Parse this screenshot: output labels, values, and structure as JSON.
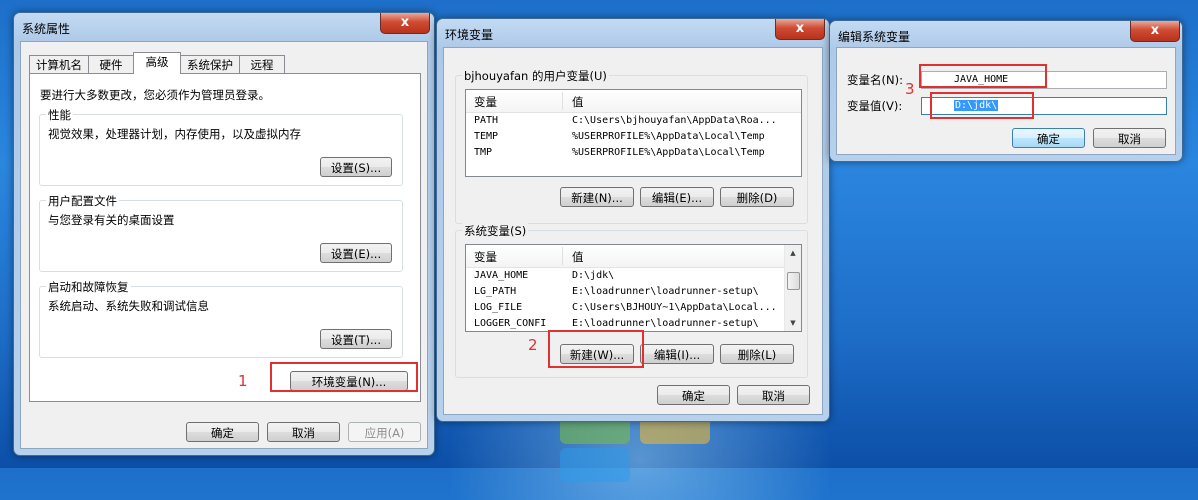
{
  "sysprops": {
    "title": "系统属性",
    "close": "x",
    "tabs": [
      "计算机名",
      "硬件",
      "高级",
      "系统保护",
      "远程"
    ],
    "admin_note": "要进行大多数更改，您必须作为管理员登录。",
    "perf": {
      "title": "性能",
      "desc": "视觉效果，处理器计划，内存使用，以及虚拟内存",
      "button": "设置(S)..."
    },
    "profile": {
      "title": "用户配置文件",
      "desc": "与您登录有关的桌面设置",
      "button": "设置(E)..."
    },
    "startup": {
      "title": "启动和故障恢复",
      "desc": "系统启动、系统失败和调试信息",
      "button": "设置(T)..."
    },
    "env_button": "环境变量(N)...",
    "ok": "确定",
    "cancel": "取消",
    "apply": "应用(A)"
  },
  "envvars": {
    "title": "环境变量",
    "close": "x",
    "user_group": "bjhouyafan 的用户变量(U)",
    "col_var": "变量",
    "col_val": "值",
    "user_vars": [
      {
        "name": "PATH",
        "value": "C:\\Users\\bjhouyafan\\AppData\\Roa..."
      },
      {
        "name": "TEMP",
        "value": "%USERPROFILE%\\AppData\\Local\\Temp"
      },
      {
        "name": "TMP",
        "value": "%USERPROFILE%\\AppData\\Local\\Temp"
      }
    ],
    "user_new": "新建(N)...",
    "user_edit": "编辑(E)...",
    "user_delete": "删除(D)",
    "sys_group": "系统变量(S)",
    "sys_vars": [
      {
        "name": "JAVA_HOME",
        "value": "D:\\jdk\\"
      },
      {
        "name": "LG_PATH",
        "value": "E:\\loadrunner\\loadrunner-setup\\"
      },
      {
        "name": "LOG_FILE",
        "value": "C:\\Users\\BJHOUY~1\\AppData\\Local..."
      },
      {
        "name": "LOGGER_CONFI",
        "value": "E:\\loadrunner\\loadrunner-setup\\"
      }
    ],
    "sys_new": "新建(W)...",
    "sys_edit": "编辑(I)...",
    "sys_delete": "删除(L)",
    "ok": "确定",
    "cancel": "取消"
  },
  "editvar": {
    "title": "编辑系统变量",
    "close": "x",
    "name_label": "变量名(N):",
    "name_value": "JAVA_HOME",
    "value_label": "变量值(V):",
    "value_value": "D:\\jdk\\",
    "ok": "确定",
    "cancel": "取消"
  },
  "annotations": {
    "step1": "1",
    "step2": "2",
    "step3": "3"
  }
}
